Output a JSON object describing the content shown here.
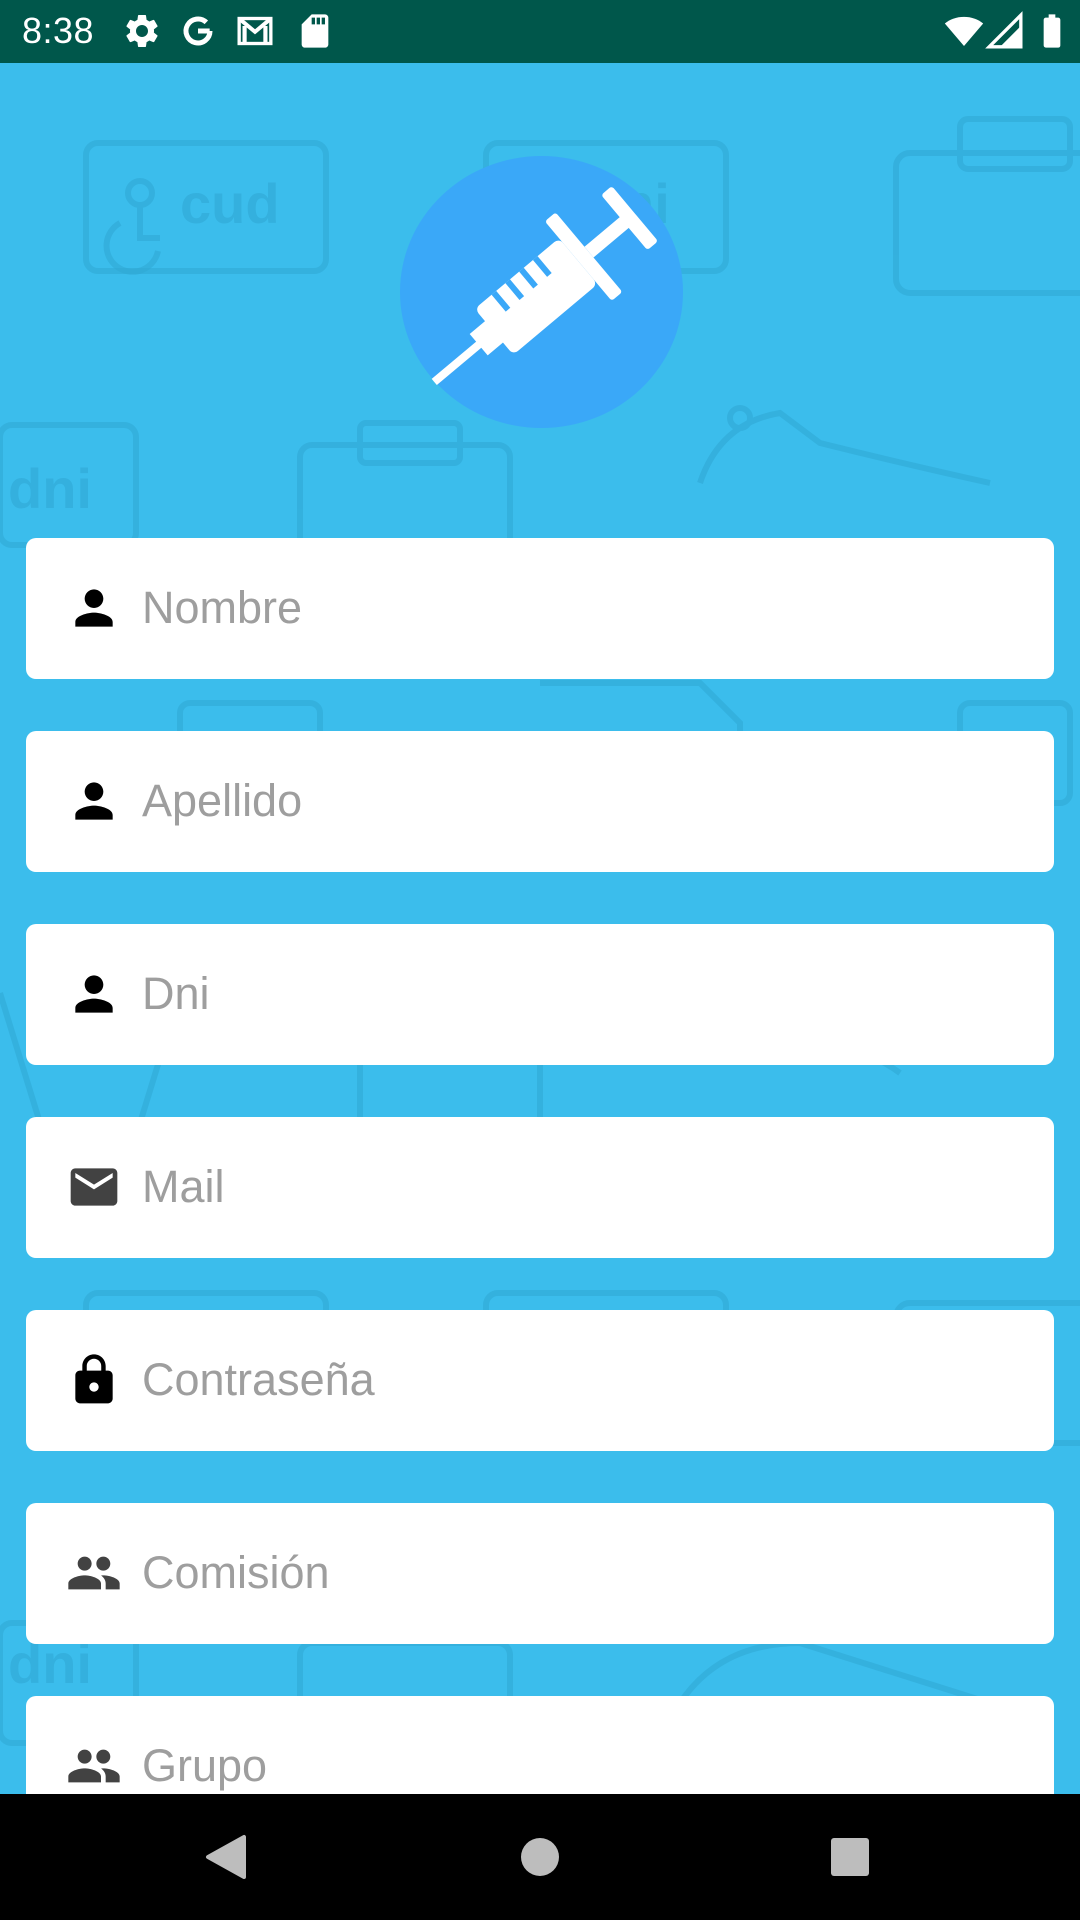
{
  "status_bar": {
    "time": "8:38",
    "icons": [
      "gear-icon",
      "google-g-icon",
      "gmail-icon",
      "sd-card-icon",
      "wifi-icon",
      "signal-icon",
      "battery-icon"
    ]
  },
  "logo": {
    "icon": "syringe-icon"
  },
  "form": {
    "fields": [
      {
        "placeholder": "Nombre",
        "icon": "person-icon"
      },
      {
        "placeholder": "Apellido",
        "icon": "person-icon"
      },
      {
        "placeholder": "Dni",
        "icon": "person-icon"
      },
      {
        "placeholder": "Mail",
        "icon": "mail-icon"
      },
      {
        "placeholder": "Contraseña",
        "icon": "lock-icon"
      },
      {
        "placeholder": "Comisión",
        "icon": "group-icon"
      },
      {
        "placeholder": "Grupo",
        "icon": "group-icon"
      }
    ]
  },
  "nav_bar": {
    "buttons": [
      "back-icon",
      "home-icon",
      "recents-icon"
    ]
  },
  "colors": {
    "status_bar_bg": "#00574b",
    "background": "#3bbdec",
    "logo_circle": "#3aa8f8",
    "field_bg": "#ffffff",
    "placeholder_text": "#9e9e9e",
    "nav_bar_bg": "#000000"
  }
}
